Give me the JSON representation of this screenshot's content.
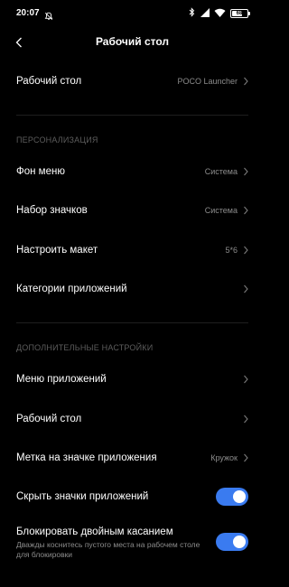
{
  "status_bar": {
    "time": "20:07",
    "battery": "68",
    "battery_level": 0.68,
    "icons": [
      "dnd-icon",
      "bluetooth-icon",
      "signal-icon",
      "wifi-icon",
      "battery-icon"
    ]
  },
  "header": {
    "title": "Рабочий стол",
    "back_icon": "back-arrow-icon"
  },
  "rows": {
    "desktop": {
      "label": "Рабочий стол",
      "value": "POCO Launcher"
    },
    "menu_background": {
      "label": "Фон меню",
      "value": "Система"
    },
    "icon_pack": {
      "label": "Набор значков",
      "value": "Система"
    },
    "layout": {
      "label": "Настроить макет",
      "value": "5*6"
    },
    "app_categories": {
      "label": "Категории приложений"
    },
    "app_menu": {
      "label": "Меню приложений"
    },
    "desktop_settings": {
      "label": "Рабочий стол"
    },
    "app_badge": {
      "label": "Метка на значке приложения",
      "value": "Кружок"
    },
    "hide_icons": {
      "label": "Скрыть значки приложений",
      "enabled": true
    },
    "double_tap_lock": {
      "label": "Блокировать двойным касанием",
      "description": "Дважды коснитесь пустого места на рабочем столе для блокировки",
      "enabled": true
    }
  },
  "sections": {
    "personalization": "ПЕРСОНАЛИЗАЦИЯ",
    "additional": "ДОПОЛНИТЕЛЬНЫЕ НАСТРОЙКИ"
  },
  "colors": {
    "background": "#000000",
    "toggle_on": "#3a7bf0",
    "secondary_text": "#8c8c8c",
    "section_text": "#5c5c5c"
  }
}
